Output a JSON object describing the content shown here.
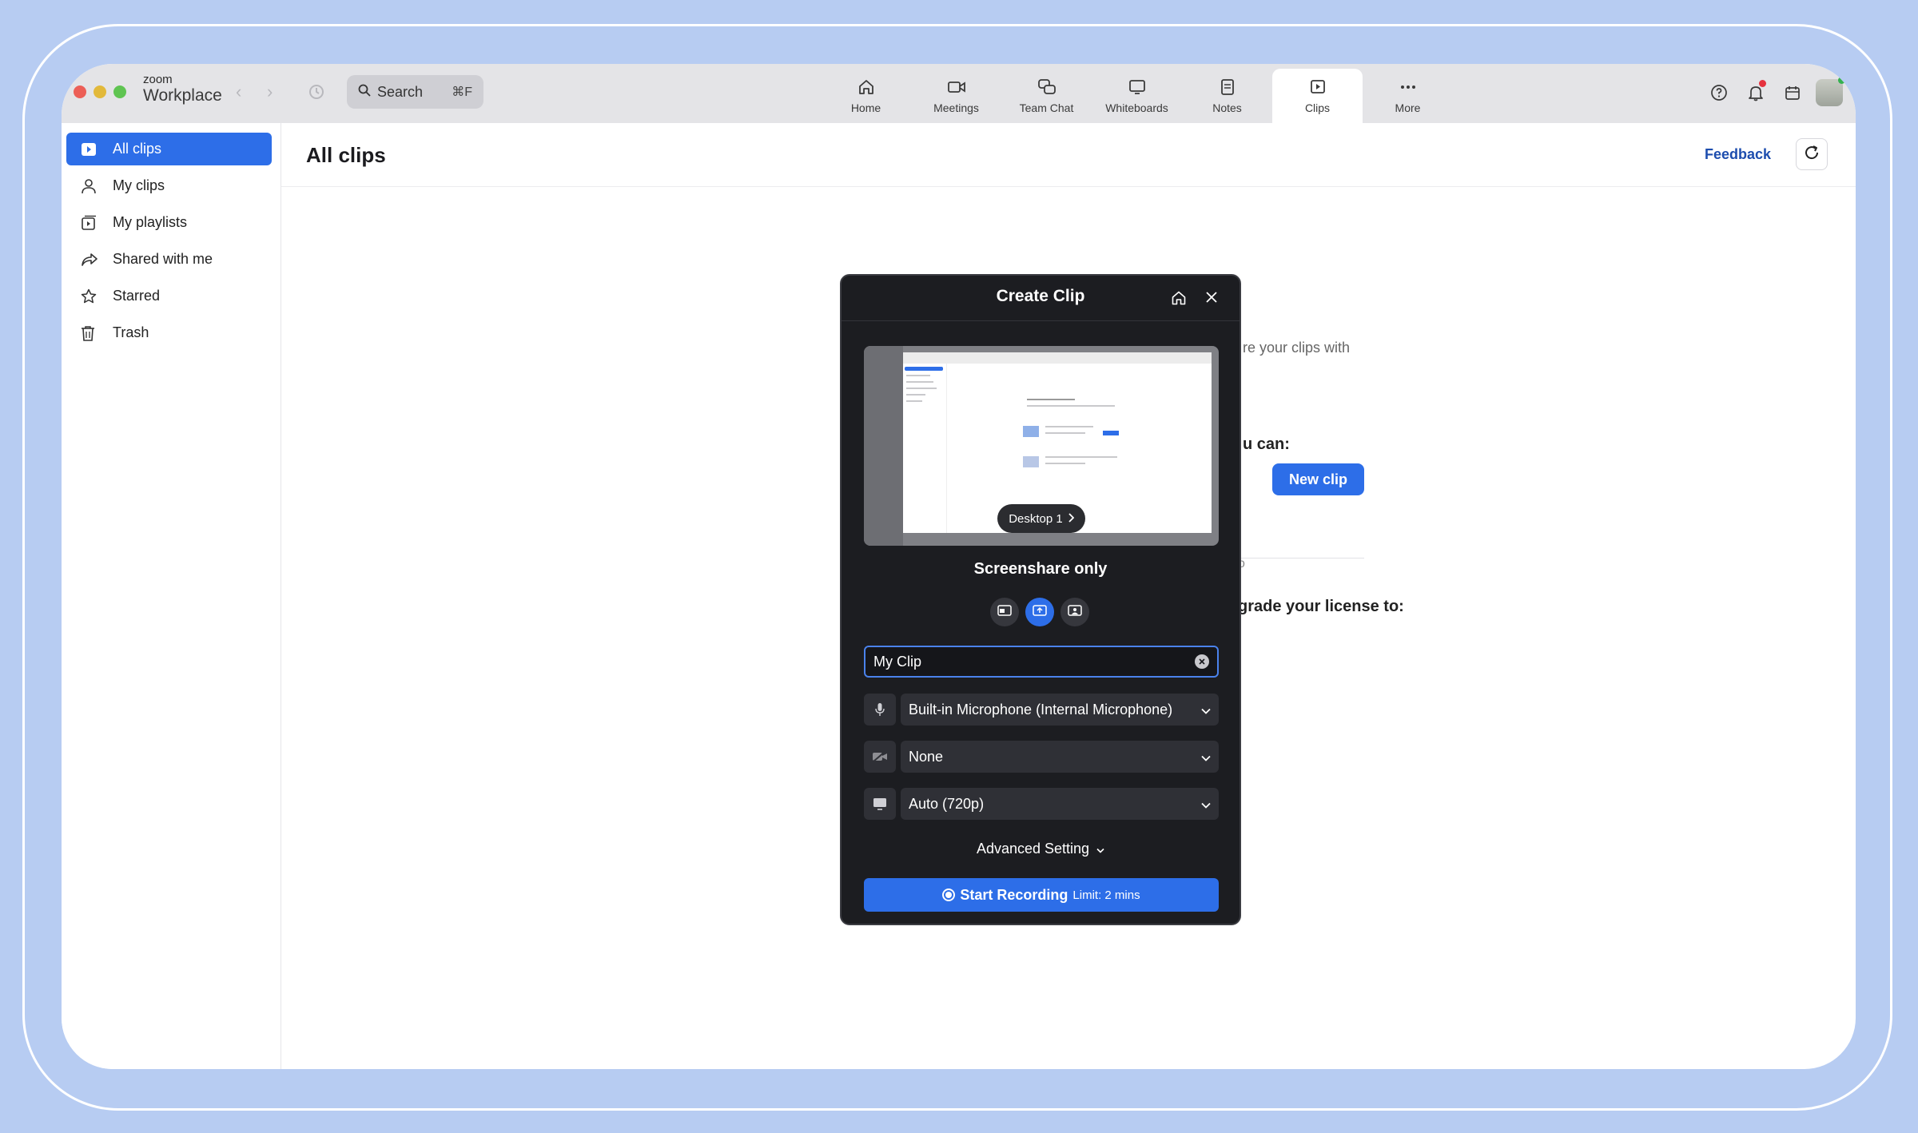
{
  "app": {
    "brand_small": "zoom",
    "brand_name": "Workplace"
  },
  "search": {
    "label": "Search",
    "shortcut": "⌘F"
  },
  "tabs": [
    {
      "label": "Home",
      "icon": "home-icon"
    },
    {
      "label": "Meetings",
      "icon": "video-camera-icon"
    },
    {
      "label": "Team Chat",
      "icon": "chat-bubbles-icon"
    },
    {
      "label": "Whiteboards",
      "icon": "whiteboard-icon"
    },
    {
      "label": "Notes",
      "icon": "notes-icon"
    },
    {
      "label": "Clips",
      "icon": "clips-icon",
      "active": true
    },
    {
      "label": "More",
      "icon": "more-dots-icon"
    }
  ],
  "sidebar": {
    "items": [
      {
        "label": "All clips",
        "icon": "clip-icon",
        "active": true
      },
      {
        "label": "My clips",
        "icon": "person-icon"
      },
      {
        "label": "My playlists",
        "icon": "playlist-icon"
      },
      {
        "label": "Shared with me",
        "icon": "share-icon"
      },
      {
        "label": "Starred",
        "icon": "star-icon"
      },
      {
        "label": "Trash",
        "icon": "trash-icon"
      }
    ]
  },
  "main": {
    "title": "All clips",
    "feedback": "Feedback",
    "bg_text_1": "re your clips with",
    "bg_text_2": "u can:",
    "bg_text_3": "o",
    "new_clip": "New clip",
    "bg_text_4": "grade your license to:"
  },
  "dialog": {
    "title": "Create Clip",
    "desktop_label": "Desktop 1",
    "mode_label": "Screenshare only",
    "clip_name": "My Clip",
    "microphone": "Built-in Microphone (Internal Microphone)",
    "camera": "None",
    "resolution": "Auto (720p)",
    "advanced": "Advanced Setting",
    "start_label": "Start Recording",
    "limit": "Limit: 2 mins"
  },
  "colors": {
    "accent": "#2d6ee8",
    "background": "#b7ccf2",
    "dialog_bg": "#1c1d21"
  }
}
